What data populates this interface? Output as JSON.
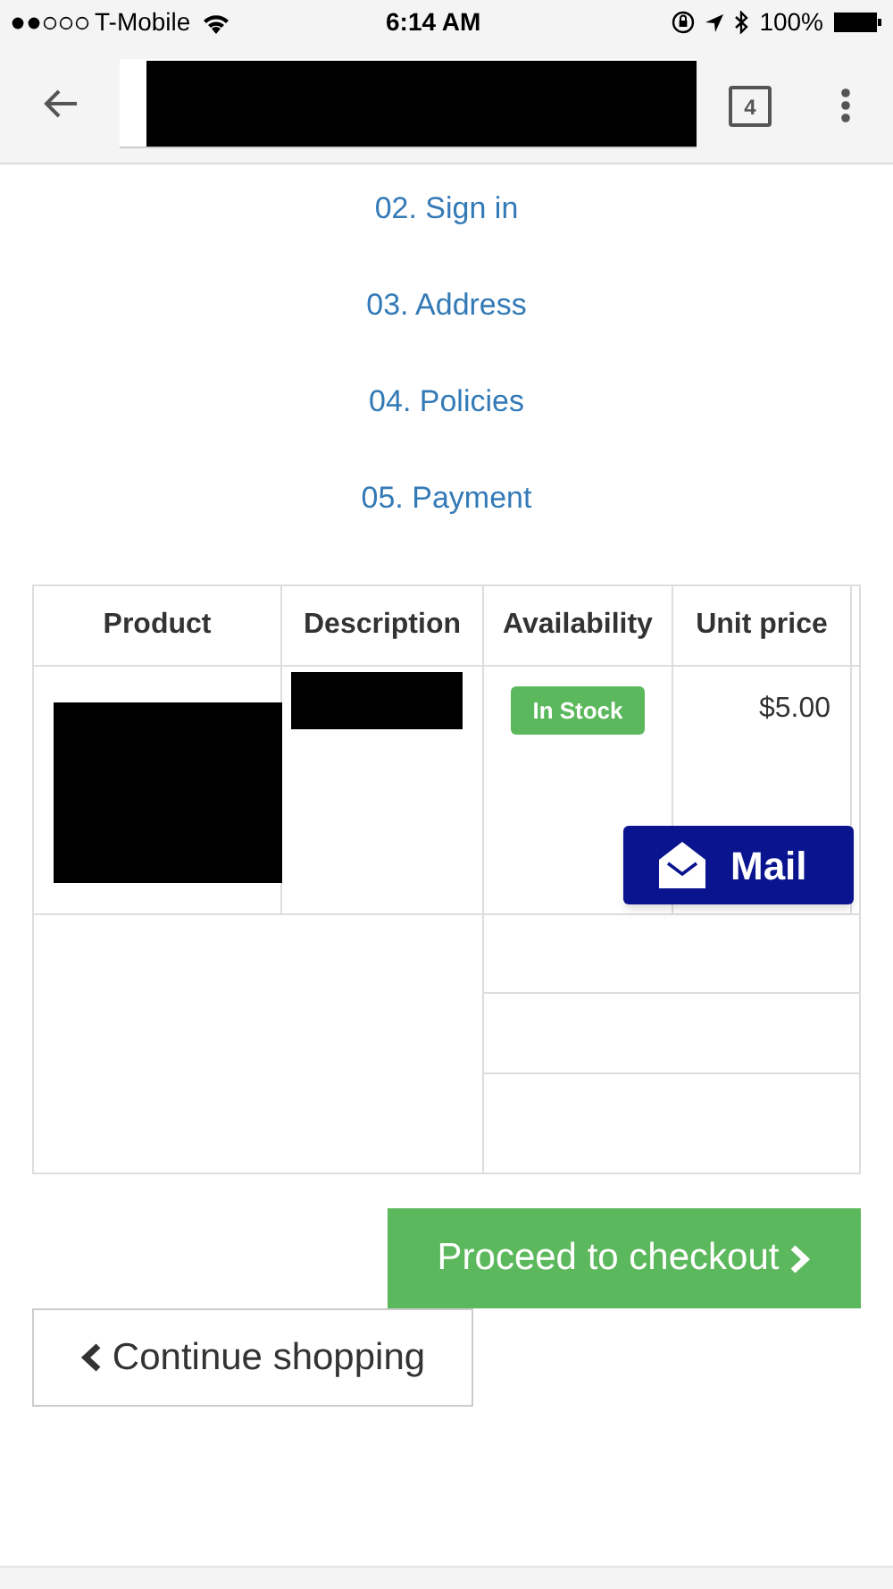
{
  "status_bar": {
    "carrier": "T-Mobile",
    "time": "6:14 AM",
    "battery": "100%"
  },
  "browser_bar": {
    "address_redacted": true,
    "tab_count": "4"
  },
  "steps": [
    {
      "label": "02. Sign in"
    },
    {
      "label": "03. Address"
    },
    {
      "label": "04. Policies"
    },
    {
      "label": "05. Payment"
    }
  ],
  "table": {
    "columns": [
      "Product",
      "Description",
      "Availability",
      "Unit price"
    ],
    "rows": [
      {
        "image_redacted": true,
        "description_redacted": true,
        "availability": "In Stock",
        "unit_price": "$5.00"
      }
    ]
  },
  "mail_button": {
    "label": "Mail"
  },
  "buttons": [
    {
      "kind": "primary",
      "label": "Proceed to checkout"
    },
    {
      "kind": "secondary",
      "label": "Continue shopping"
    }
  ]
}
